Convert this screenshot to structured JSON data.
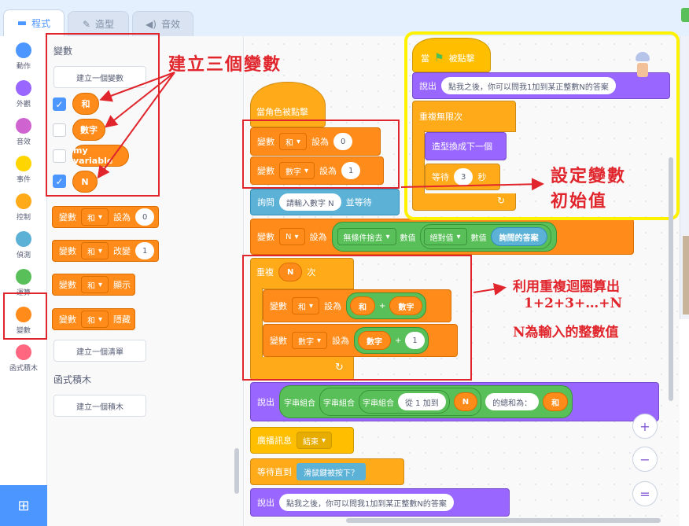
{
  "tabs": {
    "code": "程式",
    "costumes": "造型",
    "sounds": "音效"
  },
  "categories": [
    {
      "label": "動作",
      "color": "#4c97ff"
    },
    {
      "label": "外觀",
      "color": "#9966ff"
    },
    {
      "label": "音效",
      "color": "#cf63cf"
    },
    {
      "label": "事件",
      "color": "#ffd500"
    },
    {
      "label": "控制",
      "color": "#ffab19"
    },
    {
      "label": "偵測",
      "color": "#5cb1d6"
    },
    {
      "label": "運算",
      "color": "#59c059"
    },
    {
      "label": "變數",
      "color": "#ff8c1a"
    },
    {
      "label": "函式積木",
      "color": "#ff6680"
    }
  ],
  "palette": {
    "section_title": "變數",
    "make_variable": "建立一個變數",
    "variables": [
      {
        "name": "和",
        "checked": true
      },
      {
        "name": "數字",
        "checked": false
      },
      {
        "name": "my variable",
        "checked": false
      },
      {
        "name": "N",
        "checked": true
      }
    ],
    "blocks": {
      "var_label": "變數",
      "set_to": "設為",
      "set_value": "0",
      "change": "改變",
      "change_value": "1",
      "show": "顯示",
      "hide": "隱藏",
      "var_sel": "和"
    },
    "make_list": "建立一個清單",
    "func_title": "函式積木",
    "make_block": "建立一個積木"
  },
  "script_main": {
    "hat": "當角色被點擊",
    "var_label": "變數",
    "set_to": "設為",
    "set1": {
      "var": "和",
      "value": "0"
    },
    "set2": {
      "var": "數字",
      "value": "1"
    },
    "ask": {
      "label": "詢問",
      "text": "請輸入數字 N",
      "wait": "並等待"
    },
    "set3": {
      "var": "N",
      "round": "無條件捨去",
      "of": "數值",
      "abs": "絕對值",
      "of2": "數值",
      "answer": "詢問的答案"
    },
    "repeat": {
      "label": "重複",
      "count": "N",
      "suffix": "次"
    },
    "inner1": {
      "var": "和",
      "a": "和",
      "op": "+",
      "b": "數字"
    },
    "inner2": {
      "var": "數字",
      "a": "數字",
      "op": "+",
      "b": "1"
    },
    "say": {
      "label": "說出",
      "join": "字串組合",
      "text1": "從 1 加到",
      "n": "N",
      "text2": "的總和為：",
      "sum": "和"
    },
    "broadcast": {
      "label": "廣播訊息",
      "msg": "結束"
    },
    "wait_until": {
      "label": "等待直到",
      "cond": "滑鼠鍵被按下？"
    },
    "say2": {
      "label": "說出",
      "text": "點我之後，你可以問我1加到某正整數N的答案"
    }
  },
  "script_flag": {
    "hat_when": "當",
    "hat_clicked": "被點擊",
    "say_label": "說出",
    "say_text": "點我之後，你可以問我1加到某正整數N的答案",
    "forever": "重複無限次",
    "next_costume": "造型換成下一個",
    "wait": "等待",
    "wait_value": "3",
    "wait_unit": "秒"
  },
  "annotations": {
    "create_vars": "建立三個變數",
    "init_line1": "設定變數",
    "init_line2": "初始值",
    "loop_line1": "利用重複迴圈算出",
    "loop_line2": "1+2+3+…+N",
    "loop_line3": "N為輸入的整數值"
  },
  "zoom": {
    "in": "+",
    "out": "−",
    "reset": "="
  },
  "colors": {
    "accent": "#4c97ff",
    "annotation": "#e0262c",
    "variables": "#ff8c1a"
  }
}
